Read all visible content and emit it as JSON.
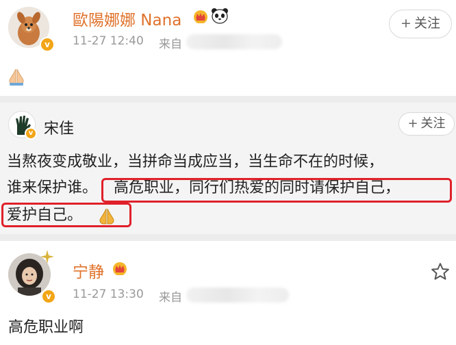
{
  "post1": {
    "username": "歐陽娜娜 Nana",
    "timestamp": "11-27 12:40",
    "source_prefix": "来自",
    "follow_label": "关注",
    "follow_plus": "+",
    "content_icon": "folded-hands-icon",
    "username_color": "#e0722b"
  },
  "post2": {
    "username": "宋佳",
    "follow_label": "关注",
    "follow_plus": "+",
    "line1": "当熬夜变成敬业，当拼命当成应当，当生命不在的时候，",
    "line2a": "谁来保护谁。",
    "line2b": "高危职业，同行们热爱的同时请保护自己，",
    "line3": "爱护自己。",
    "highlight_color": "#e0202a"
  },
  "post3": {
    "username": "宁静",
    "timestamp": "11-27 13:30",
    "source_prefix": "来自",
    "content": "高危职业啊",
    "star_icon": "star-outline-icon",
    "username_color": "#e0722b"
  },
  "badge": {
    "verified_char": "v",
    "verified_color": "#f2a516"
  }
}
